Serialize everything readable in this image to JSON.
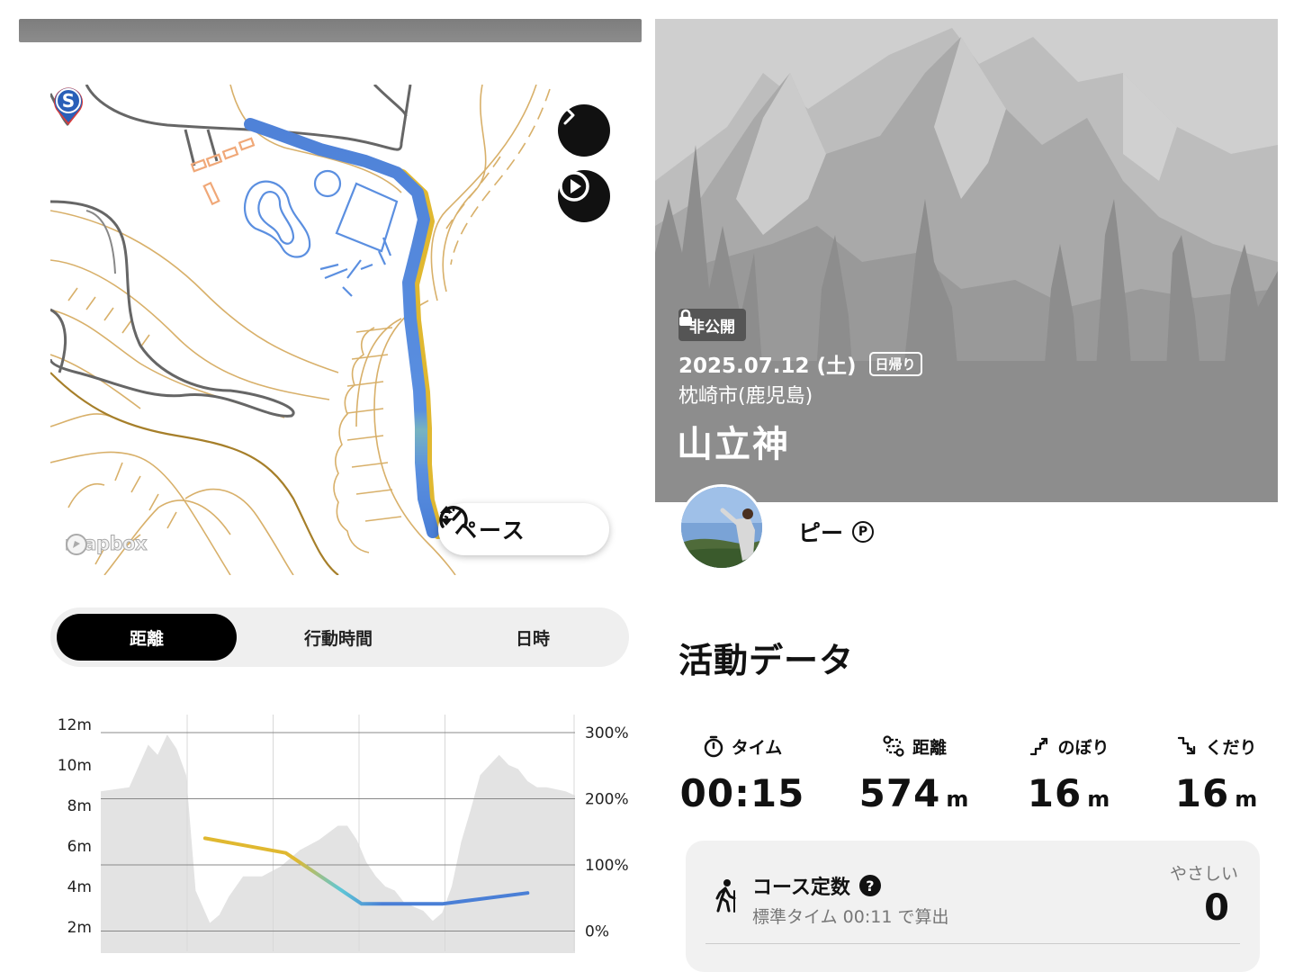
{
  "map": {
    "start_marker": "S",
    "pace_label": "ペース",
    "attribution": "mapbox",
    "icons": [
      "chevron-right-icon",
      "play-icon",
      "speedometer-icon",
      "sort-icon",
      "mapbox-logo-icon"
    ]
  },
  "tabs": [
    {
      "label": "距離",
      "active": true
    },
    {
      "label": "行動時間",
      "active": false
    },
    {
      "label": "日時",
      "active": false
    }
  ],
  "chart_data": {
    "type": "area",
    "y_left_ticks": [
      "12m",
      "10m",
      "8m",
      "6m",
      "4m",
      "2m"
    ],
    "y_right_ticks": [
      "300%",
      "200%",
      "100%",
      "0%"
    ],
    "ylim_left": [
      2,
      12
    ],
    "ylim_right": [
      0,
      300
    ],
    "elevation": {
      "name": "",
      "x": [
        0,
        0.03,
        0.06,
        0.1,
        0.12,
        0.14,
        0.16,
        0.18,
        0.2,
        0.23,
        0.25,
        0.27,
        0.3,
        0.34,
        0.38,
        0.42,
        0.46,
        0.5,
        0.52,
        0.54,
        0.56,
        0.58,
        0.6,
        0.62,
        0.64,
        0.66,
        0.68,
        0.7,
        0.72,
        0.74,
        0.76,
        0.78,
        0.8,
        0.82,
        0.84,
        0.86,
        0.88,
        0.9,
        0.92,
        0.94,
        0.96,
        0.98,
        1.0
      ],
      "values": [
        8.7,
        8.8,
        8.9,
        11.0,
        10.5,
        11.5,
        10.8,
        9.5,
        3.8,
        2.2,
        2.6,
        3.5,
        4.5,
        4.5,
        5.0,
        5.8,
        6.3,
        7.0,
        7.0,
        6.3,
        5.2,
        4.5,
        4.0,
        3.8,
        3.2,
        3.0,
        2.8,
        2.3,
        2.7,
        4.0,
        6.2,
        7.8,
        9.5,
        10.0,
        10.5,
        10.0,
        9.8,
        9.2,
        8.9,
        8.9,
        8.8,
        8.7,
        8.5
      ]
    },
    "pace": {
      "name": "",
      "x": [
        0.22,
        0.39,
        0.55,
        0.72,
        0.9
      ],
      "values": [
        155,
        135,
        65,
        65,
        80
      ]
    },
    "colors": {
      "elevation_fill": "#e3e3e3",
      "pace_start": "#e0b830",
      "pace_mid": "#5ec7d6",
      "pace_end": "#4a7fd6"
    }
  },
  "hero": {
    "privacy": "非公開",
    "date": "2025.07.12 (土)",
    "trip_type": "日帰り",
    "location": "枕崎市(鹿児島)",
    "title": "山立神",
    "icons": [
      "lock-icon"
    ]
  },
  "user": {
    "name": "ピー",
    "badge": "P"
  },
  "activity": {
    "title": "活動データ",
    "stats": [
      {
        "label": "タイム",
        "value": "00:15",
        "unit": "",
        "icon": "stopwatch-icon"
      },
      {
        "label": "距離",
        "value": "574",
        "unit": "m",
        "icon": "route-icon"
      },
      {
        "label": "のぼり",
        "value": "16",
        "unit": "m",
        "icon": "ascent-icon"
      },
      {
        "label": "くだり",
        "value": "16",
        "unit": "m",
        "icon": "descent-icon"
      }
    ]
  },
  "course": {
    "title": "コース定数",
    "subtitle": "標準タイム 00:11 で算出",
    "level": "やさしい",
    "value": "0",
    "icons": [
      "hiker-icon",
      "help-icon"
    ]
  }
}
